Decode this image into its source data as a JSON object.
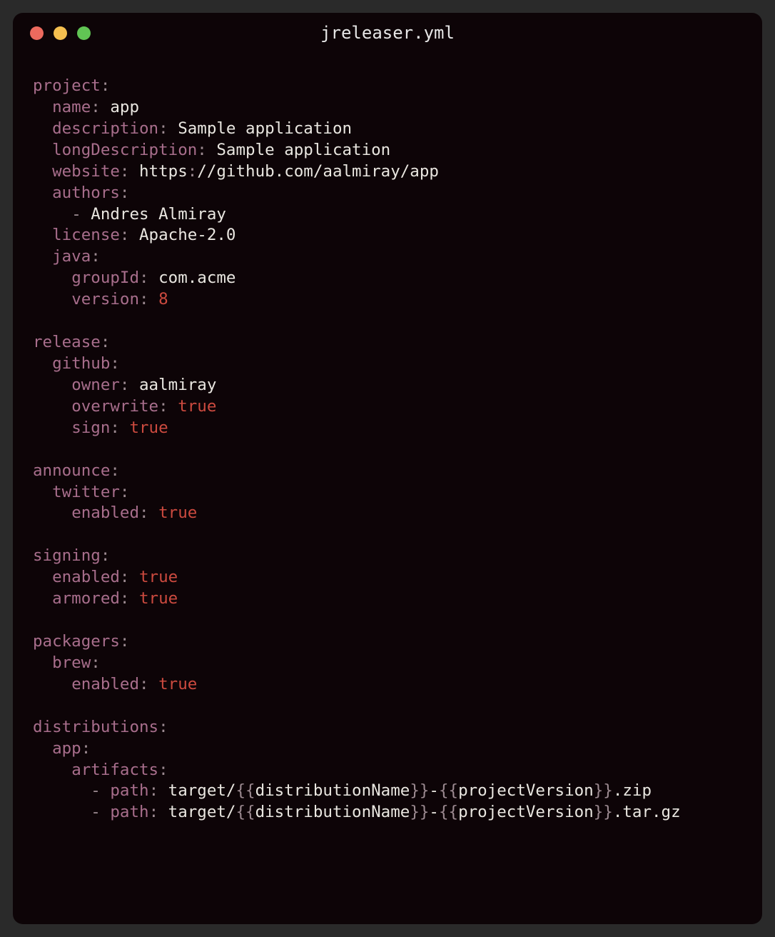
{
  "window": {
    "title": "jreleaser.yml"
  },
  "code": {
    "project": {
      "key": "project",
      "name_key": "name",
      "name": "app",
      "description_key": "description",
      "description": "Sample application",
      "longDescription_key": "longDescription",
      "longDescription": "Sample application",
      "website_key": "website",
      "website_scheme": "https",
      "website_rest": "//github.com/aalmiray/app",
      "authors_key": "authors",
      "author0": "Andres Almiray",
      "license_key": "license",
      "license": "Apache-2.0",
      "java_key": "java",
      "java": {
        "groupId_key": "groupId",
        "groupId": "com.acme",
        "version_key": "version",
        "version": "8"
      }
    },
    "release": {
      "key": "release",
      "github_key": "github",
      "github": {
        "owner_key": "owner",
        "owner": "aalmiray",
        "overwrite_key": "overwrite",
        "overwrite": "true",
        "sign_key": "sign",
        "sign": "true"
      }
    },
    "announce": {
      "key": "announce",
      "twitter_key": "twitter",
      "twitter": {
        "enabled_key": "enabled",
        "enabled": "true"
      }
    },
    "signing": {
      "key": "signing",
      "enabled_key": "enabled",
      "enabled": "true",
      "armored_key": "armored",
      "armored": "true"
    },
    "packagers": {
      "key": "packagers",
      "brew_key": "brew",
      "brew": {
        "enabled_key": "enabled",
        "enabled": "true"
      }
    },
    "distributions": {
      "key": "distributions",
      "app_key": "app",
      "artifacts_key": "artifacts",
      "artifact0": {
        "path_key": "path",
        "pre": "target/",
        "var1": "distributionName",
        "mid": "-",
        "var2": "projectVersion",
        "ext": ".zip"
      },
      "artifact1": {
        "path_key": "path",
        "pre": "target/",
        "var1": "distributionName",
        "mid": "-",
        "var2": "projectVersion",
        "ext": ".tar.gz"
      }
    }
  },
  "glyph": {
    "colon": ":",
    "dash": "-",
    "lbrace2": "{{",
    "rbrace2": "}}"
  }
}
